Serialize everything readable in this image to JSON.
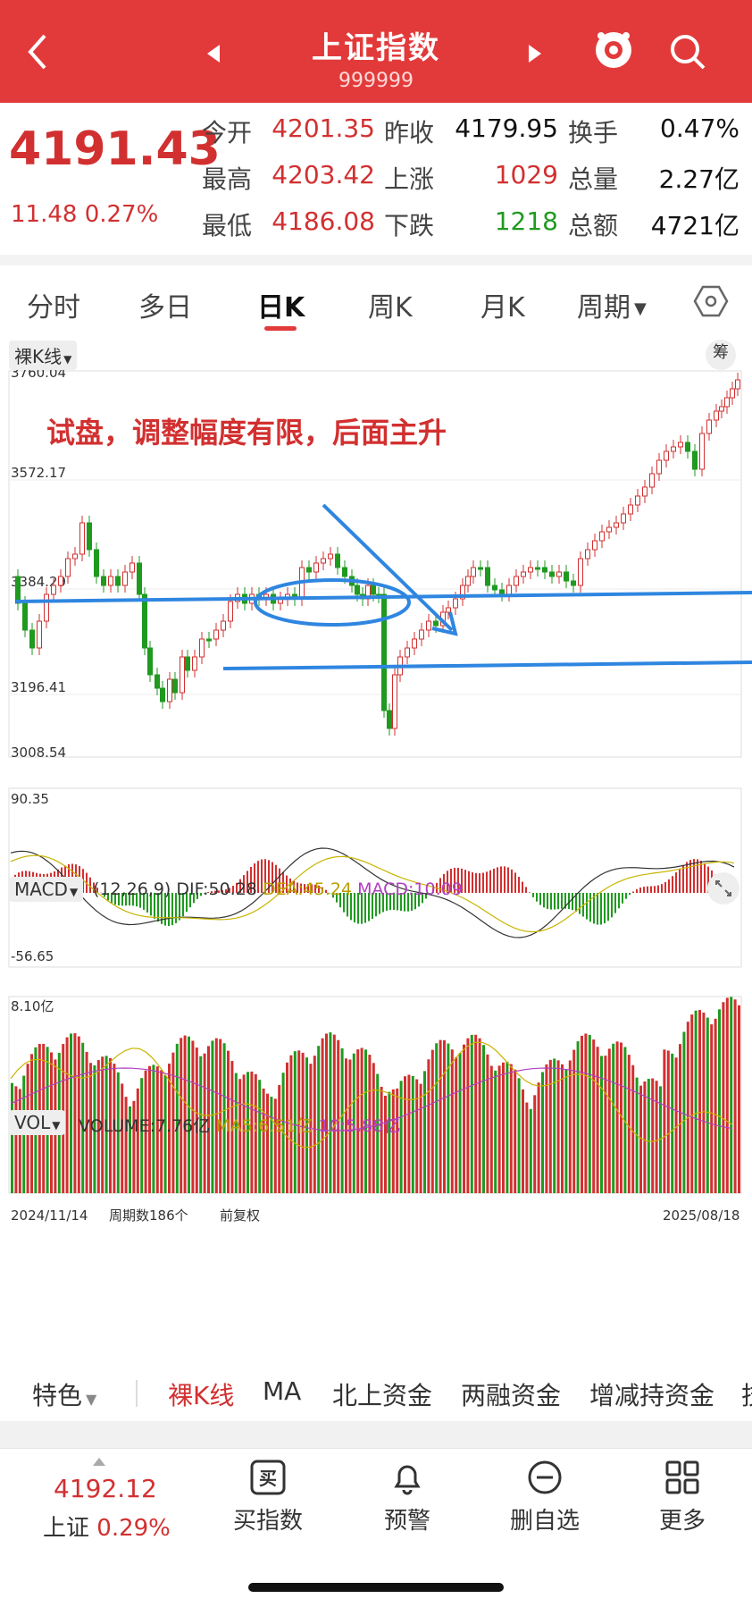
{
  "header": {
    "title": "上证指数",
    "code": "999999"
  },
  "quote": {
    "price": "4191.43",
    "change": "11.48 0.27%",
    "rows": [
      {
        "l1": "今开",
        "v1": "4201.35",
        "c1": "red",
        "l2": "昨收",
        "v2": "4179.95",
        "c2": "dark",
        "l3": "换手",
        "v3": "0.47%",
        "c3": "dark"
      },
      {
        "l1": "最高",
        "v1": "4203.42",
        "c1": "red",
        "l2": "上涨",
        "v2": "1029",
        "c2": "red",
        "l3": "总量",
        "v3": "2.27亿",
        "c3": "dark"
      },
      {
        "l1": "最低",
        "v1": "4186.08",
        "c1": "red",
        "l2": "下跌",
        "v2": "1218",
        "c2": "green",
        "l3": "总额",
        "v3": "4721亿",
        "c3": "dark"
      }
    ]
  },
  "tabs": [
    "分时",
    "多日",
    "日K",
    "周K",
    "月K",
    "周期"
  ],
  "active_tab": "日K",
  "kchart": {
    "tag": "裸K线",
    "chip_label": "筹",
    "yticks": [
      "3760.04",
      "3572.17",
      "3384.29",
      "3196.41",
      "3008.54"
    ],
    "annotation": "试盘，调整幅度有限，后面主升"
  },
  "macd": {
    "tag": "MACD",
    "params": "(12,26,9)",
    "dif_label": "DIF:50.28",
    "dea_label": "DEA:45.24",
    "macd_label": "MACD:10.09",
    "top": "90.35",
    "bottom": "-56.65"
  },
  "vol": {
    "tag": "VOL",
    "volume_label": "VOLUME:7.76亿",
    "ma5_label": "MA5:6.51亿",
    "ma10_label": "10:5.88亿",
    "top": "8.10亿"
  },
  "xaxis": {
    "start": "2024/11/14",
    "count": "周期数186个",
    "adj": "前复权",
    "end": "2025/08/18"
  },
  "fund_tabs": [
    "特色",
    "裸K线",
    "MA",
    "北上资金",
    "两融资金",
    "增减持资金",
    "技"
  ],
  "bottom": {
    "price": "4192.12",
    "name": "上证",
    "pct": "0.29%",
    "items": [
      "买指数",
      "预警",
      "删自选",
      "更多"
    ],
    "buy_icon_char": "买"
  },
  "colors": {
    "up": "#d23030",
    "down": "#1f9a1f",
    "brand": "#e23a3a",
    "line": "#2f86e0",
    "dea": "#c8b400",
    "macd": "#b040c0"
  }
}
